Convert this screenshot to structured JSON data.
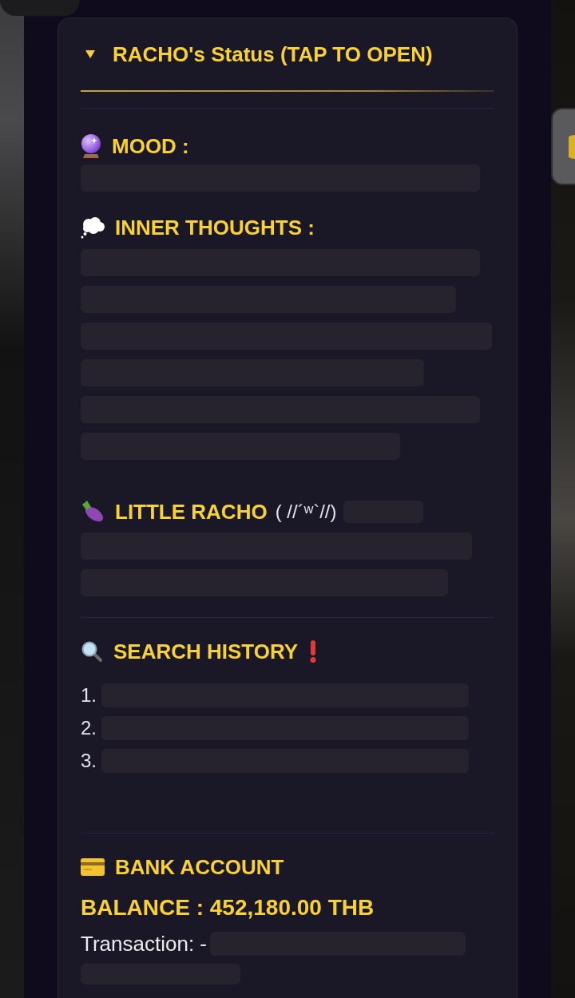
{
  "status_panel": {
    "title": "RACHO's Status (TAP TO OPEN)",
    "expanded": true
  },
  "groups": [
    {
      "sections": [
        {
          "kind": "text",
          "heading": "MOOD :"
        },
        {
          "kind": "text",
          "heading": "INNER THOUGHTS :"
        },
        {
          "kind": "text",
          "heading": "LITTLE RACHO",
          "kaomoji": "( //´ʷ`//)"
        }
      ]
    },
    {
      "sections": [
        {
          "kind": "list",
          "heading": "SEARCH HISTORY",
          "items": [
            "1.",
            "2.",
            "3."
          ]
        }
      ]
    },
    {
      "sections": [
        {
          "kind": "bank",
          "heading": "BANK ACCOUNT",
          "balance": "BALANCE : 452,180.00 THB",
          "transaction": "Transaction: -"
        }
      ]
    }
  ]
}
